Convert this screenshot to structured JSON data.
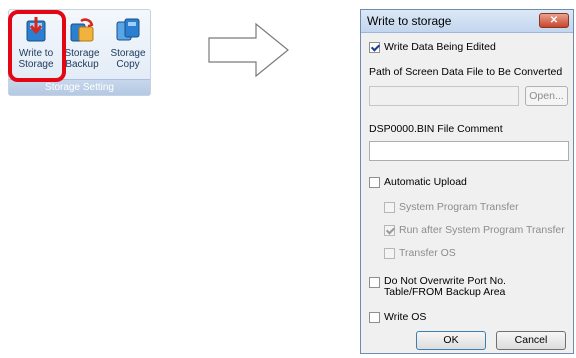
{
  "ribbon": {
    "buttons": [
      {
        "label": "Write to\nStorage",
        "icon": "write-to-storage-icon"
      },
      {
        "label": "Storage\nBackup",
        "icon": "storage-backup-icon"
      },
      {
        "label": "Storage\nCopy",
        "icon": "storage-copy-icon"
      }
    ],
    "group_caption": "Storage Setting",
    "highlight_color": "#e30613"
  },
  "dialog": {
    "title": "Write to storage",
    "close_glyph": "✕",
    "write_data_being_edited": {
      "label": "Write Data Being Edited",
      "checked": true
    },
    "path_label": "Path of Screen Data File to Be Converted",
    "path_value": "",
    "open_button": "Open...",
    "comment_label": "DSP0000.BIN File Comment",
    "comment_value": "",
    "automatic_upload": {
      "label": "Automatic Upload",
      "checked": false
    },
    "system_program_transfer": {
      "label": "System Program Transfer",
      "checked": false
    },
    "run_after_transfer": {
      "label": "Run after System Program Transfer",
      "checked": true
    },
    "transfer_os": {
      "label": "Transfer OS",
      "checked": false
    },
    "do_not_overwrite_line1": "Do Not Overwrite Port No.",
    "do_not_overwrite_line2": "Table/FROM Backup Area",
    "do_not_overwrite_checked": false,
    "write_os": {
      "label": "Write OS",
      "checked": false
    },
    "ok_button": "OK",
    "cancel_button": "Cancel"
  }
}
